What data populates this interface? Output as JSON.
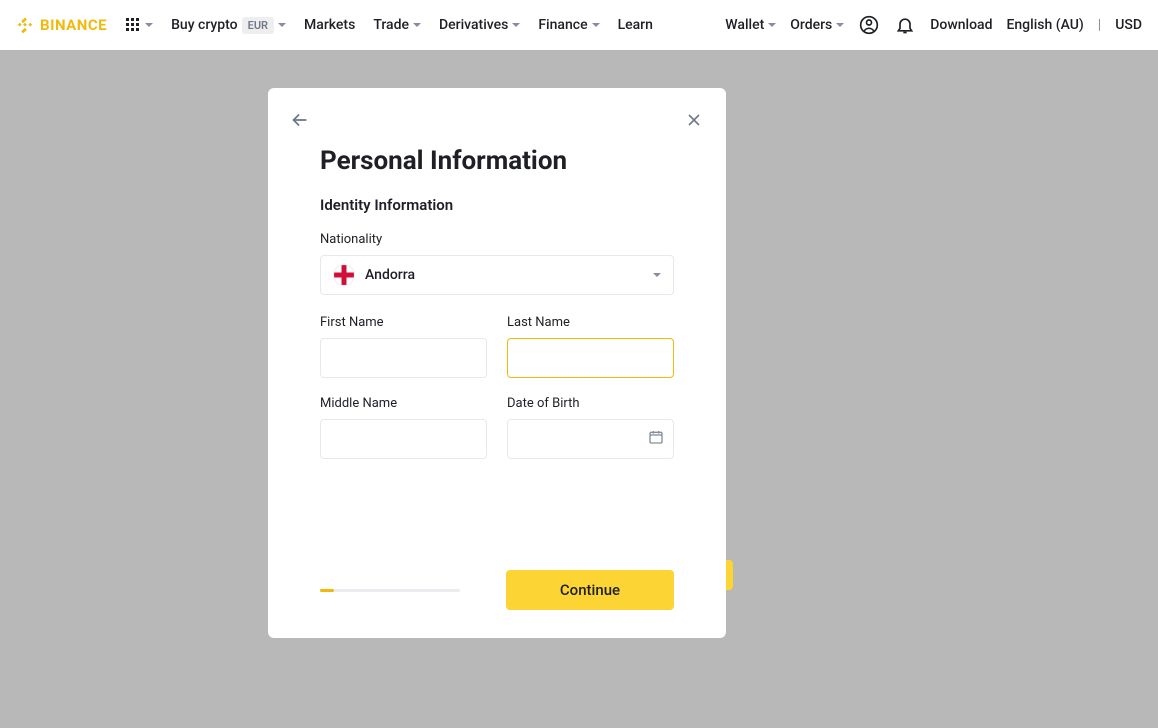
{
  "brand": "BINANCE",
  "nav": {
    "buy_crypto": "Buy crypto",
    "eur_badge": "EUR",
    "markets": "Markets",
    "trade": "Trade",
    "derivatives": "Derivatives",
    "finance": "Finance",
    "learn": "Learn"
  },
  "right": {
    "wallet": "Wallet",
    "orders": "Orders",
    "download": "Download",
    "language": "English (AU)",
    "currency": "USD"
  },
  "modal": {
    "title": "Personal Information",
    "section": "Identity Information",
    "nationality_label": "Nationality",
    "nationality_value": "Andorra",
    "first_name_label": "First Name",
    "last_name_label": "Last Name",
    "middle_name_label": "Middle Name",
    "dob_label": "Date of Birth",
    "continue": "Continue"
  }
}
